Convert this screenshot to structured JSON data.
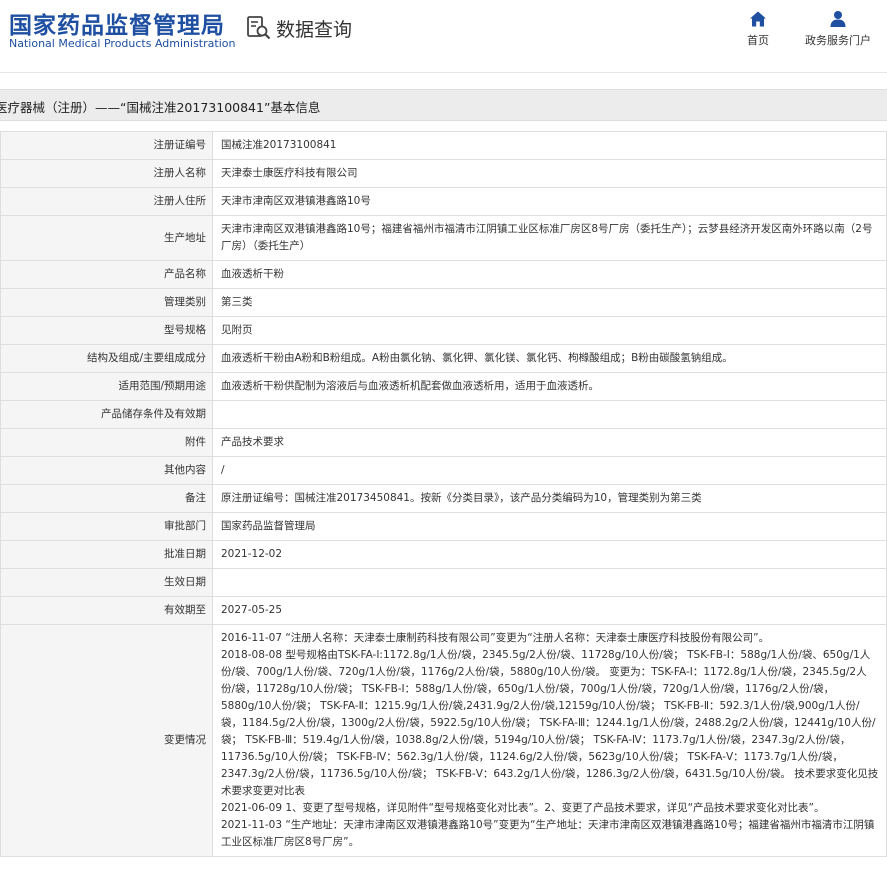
{
  "header": {
    "logo_cn": "国家药品监督管理局",
    "logo_en": "National Medical Products Administration",
    "query_title": "数据查询",
    "nav": [
      {
        "label": "首页",
        "icon": "home-icon"
      },
      {
        "label": "政务服务门户",
        "icon": "user-icon"
      }
    ],
    "brand_color": "#1e4fa1"
  },
  "title_bar": "医疗器械（注册）——“国械注准20173100841”基本信息",
  "rows": [
    {
      "label": "注册证编号",
      "value": "国械注准20173100841"
    },
    {
      "label": "注册人名称",
      "value": "天津泰士康医疗科技有限公司"
    },
    {
      "label": "注册人住所",
      "value": "天津市津南区双港镇港鑫路10号"
    },
    {
      "label": "生产地址",
      "value": "天津市津南区双港镇港鑫路10号；福建省福州市福清市江阴镇工业区标准厂房区8号厂房（委托生产）；云梦县经济开发区南外环路以南（2号厂房）（委托生产）"
    },
    {
      "label": "产品名称",
      "value": "血液透析干粉"
    },
    {
      "label": "管理类别",
      "value": "第三类"
    },
    {
      "label": "型号规格",
      "value": "见附页"
    },
    {
      "label": "结构及组成/主要组成成分",
      "value": "血液透析干粉由A粉和B粉组成。A粉由氯化钠、氯化钾、氯化镁、氯化钙、枸橼酸组成；B粉由碳酸氢钠组成。"
    },
    {
      "label": "适用范围/预期用途",
      "value": "血液透析干粉供配制为溶液后与血液透析机配套做血液透析用，适用于血液透析。"
    },
    {
      "label": "产品储存条件及有效期",
      "value": ""
    },
    {
      "label": "附件",
      "value": "产品技术要求"
    },
    {
      "label": "其他内容",
      "value": "/"
    },
    {
      "label": "备注",
      "value": "原注册证编号：国械注准20173450841。按新《分类目录》，该产品分类编码为10，管理类别为第三类"
    },
    {
      "label": "审批部门",
      "value": "国家药品监督管理局"
    },
    {
      "label": "批准日期",
      "value": "2021-12-02"
    },
    {
      "label": "生效日期",
      "value": ""
    },
    {
      "label": "有效期至",
      "value": "2027-05-25"
    }
  ],
  "changes": {
    "label": "变更情况",
    "entries": [
      "2016-11-07 “注册人名称：天津泰士康制药科技有限公司”变更为“注册人名称：天津泰士康医疗科技股份有限公司”。",
      "2018-08-08 型号规格由TSK-FA-Ⅰ:1172.8g/1人份/袋，2345.5g/2人份/袋、11728g/10人份/袋； TSK-FB-Ⅰ：588g/1人份/袋、650g/1人份/袋、700g/1人份/袋、720g/1人份/袋，1176g/2人份/袋，5880g/10人份/袋。 变更为：TSK-FA-Ⅰ：1172.8g/1人份/袋，2345.5g/2人份/袋，11728g/10人份/袋； TSK-FB-Ⅰ：588g/1人份/袋，650g/1人份/袋，700g/1人份/袋，720g/1人份/袋，1176g/2人份/袋，5880g/10人份/袋； TSK-FA-Ⅱ：1215.9g/1人份/袋,2431.9g/2人份/袋,12159g/10人份/袋； TSK-FB-Ⅱ：592.3/1人份/袋,900g/1人份/袋，1184.5g/2人份/袋，1300g/2人份/袋，5922.5g/10人份/袋； TSK-FA-Ⅲ：1244.1g/1人份/袋，2488.2g/2人份/袋，12441g/10人份/袋； TSK-FB-Ⅲ：519.4g/1人份/袋，1038.8g/2人份/袋，5194g/10人份/袋； TSK-FA-Ⅳ：1173.7g/1人份/袋，2347.3g/2人份/袋，11736.5g/10人份/袋； TSK-FB-Ⅳ：562.3g/1人份/袋，1124.6g/2人份/袋，5623g/10人份/袋； TSK-FA-Ⅴ：1173.7g/1人份/袋，2347.3g/2人份/袋，11736.5g/10人份/袋； TSK-FB-Ⅴ：643.2g/1人份/袋，1286.3g/2人份/袋，6431.5g/10人份/袋。 技术要求变化见技术要求变更对比表",
      "2021-06-09 1、变更了型号规格，详见附件“型号规格变化对比表”。2、变更了产品技术要求，详见“产品技术要求变化对比表”。",
      "2021-11-03 “生产地址：天津市津南区双港镇港鑫路10号”变更为“生产地址：天津市津南区双港镇港鑫路10号；福建省福州市福清市江阴镇工业区标准厂房区8号厂房”。"
    ]
  }
}
